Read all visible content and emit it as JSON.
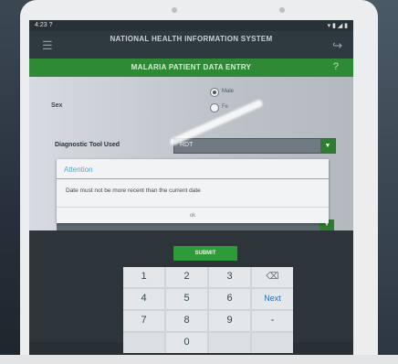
{
  "status_bar": {
    "time": "4:23 ?",
    "icons": "▾ ▮ ◢ ▮"
  },
  "app_bar": {
    "title": "NATIONAL HEALTH INFORMATION SYSTEM",
    "back_icon": "back-icon",
    "exit_icon": "exit-icon"
  },
  "form_header": {
    "title": "MALARIA PATIENT DATA ENTRY",
    "help": "?"
  },
  "form": {
    "sex_label": "Sex",
    "sex_options": {
      "male": "Male",
      "female": "Fe"
    },
    "sex_selected": "male",
    "diagnostic_label": "Diagnostic Tool Used",
    "diagnostic_value": "RDT"
  },
  "dialog": {
    "title": "Attention",
    "message": "Date must not be more recent than the current date",
    "ok": "ok"
  },
  "submit_label": "SUBMIT",
  "keypad": {
    "keys": [
      "1",
      "2",
      "3",
      "⌫",
      "4",
      "5",
      "6",
      "Next",
      "7",
      "8",
      "9",
      "-",
      "",
      "0",
      "",
      ""
    ]
  },
  "colors": {
    "app_green": "#2f8a35",
    "dialog_title_blue": "#58a6c9",
    "dropdown_green": "#2e7d32"
  }
}
